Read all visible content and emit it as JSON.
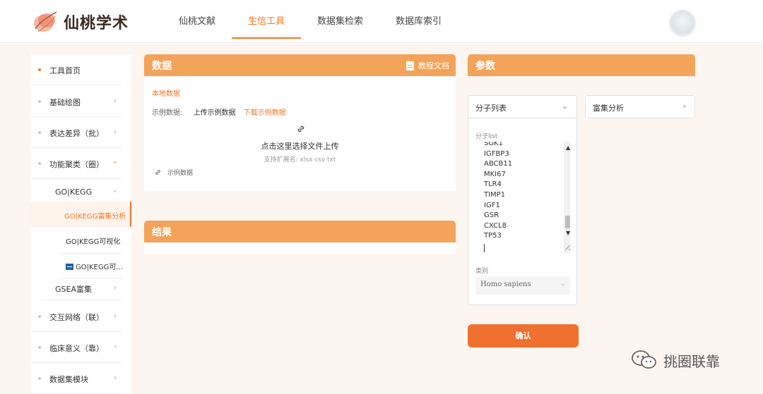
{
  "header": {
    "logo_text": "仙桃学术",
    "nav": [
      {
        "label": "仙桃文献"
      },
      {
        "label": "生信工具"
      },
      {
        "label": "数据集检索"
      },
      {
        "label": "数据库索引"
      }
    ],
    "active_nav": "生信工具"
  },
  "sidebar": {
    "items": [
      {
        "label": "工具首页"
      },
      {
        "label": "基础绘图"
      },
      {
        "label": "表达差异（批）"
      },
      {
        "label": "功能聚类（圈）"
      },
      {
        "label": "交互网络（联）"
      },
      {
        "label": "临床意义（靠）"
      },
      {
        "label": "数据集模块"
      }
    ],
    "sub": {
      "gokegg": "GO|KEGG",
      "gokegg_enrich": "GO|KEGG富集分析",
      "gokegg_visual": "GO|KEGG可视化",
      "gokegg_more": "GO|KEGG可...",
      "gsea": "GSEA富集"
    }
  },
  "data_panel": {
    "title": "数据",
    "doc_link": "教程文档",
    "local_data": "本地数据",
    "example_label": "示例数据:",
    "upload_example": "上传示例数据",
    "download_example": "下载示例数据",
    "upload_prompt": "点击这里选择文件上传",
    "ext_hint": "支持扩展名: xlsx csv txt",
    "sample_data": "示例数据"
  },
  "result_panel": {
    "title": "结果"
  },
  "param_panel": {
    "title": "参数",
    "molecule_select": "分子列表",
    "analysis_select": "富集分析",
    "list_label": "分子list",
    "molecules": [
      "SGK1",
      "IGFBP3",
      "ABCB11",
      "MKI67",
      "TLR4",
      "TIMP1",
      "IGF1",
      "GSR",
      "CXCL8",
      "TP53"
    ],
    "category_label": "类别",
    "species": "Homo sapiens",
    "confirm": "确认"
  },
  "watermark": "挑圈联靠",
  "colors": {
    "accent": "#f07828",
    "panel_header": "#f3a45a",
    "button": "#f07030",
    "background": "#fdf5f0"
  }
}
